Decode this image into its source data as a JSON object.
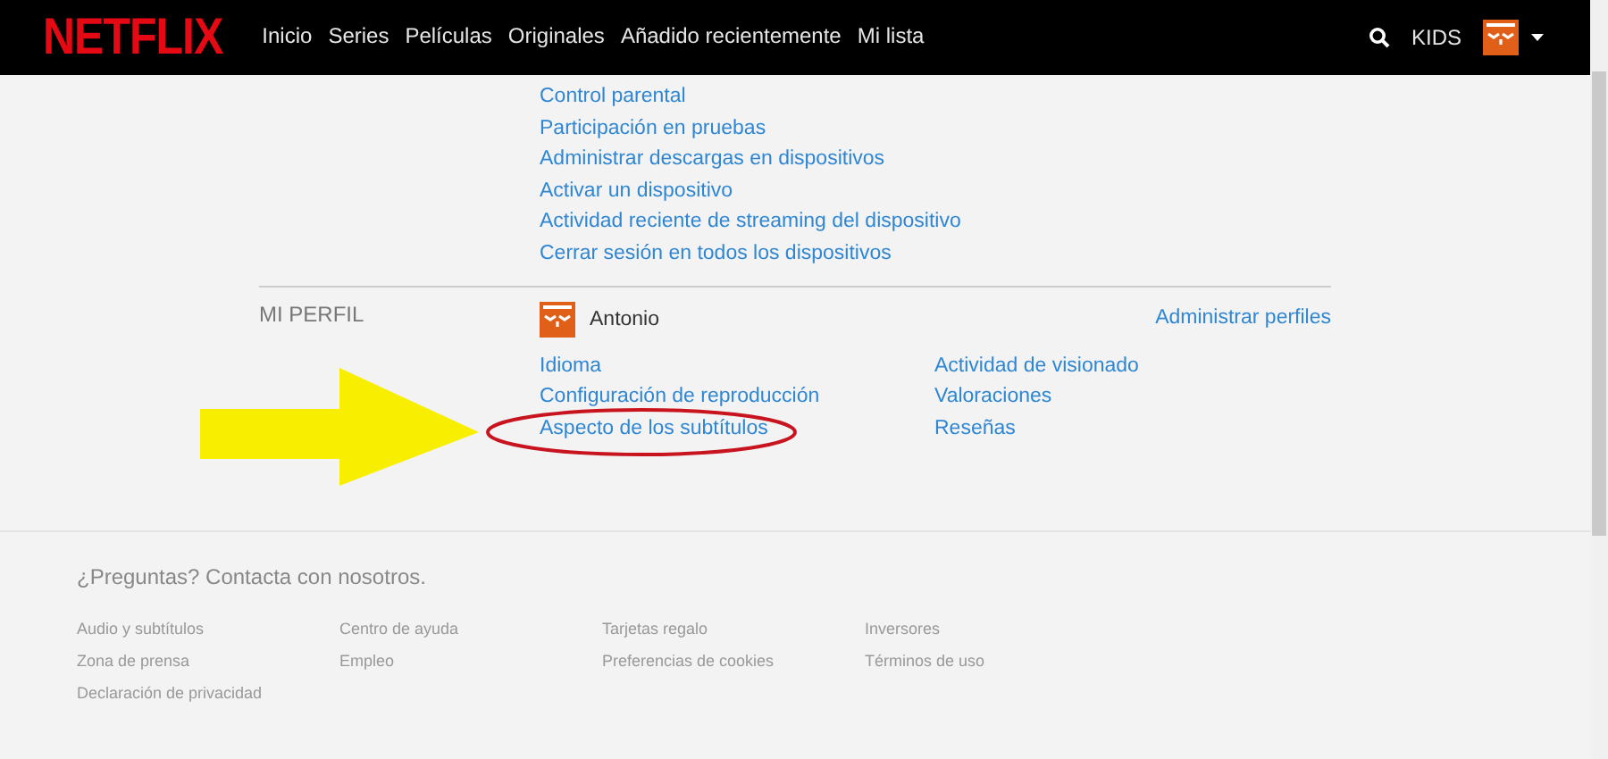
{
  "header": {
    "logo": "NETFLIX",
    "nav": [
      {
        "label": "Inicio"
      },
      {
        "label": "Series"
      },
      {
        "label": "Películas"
      },
      {
        "label": "Originales"
      },
      {
        "label": "Añadido recientemente"
      },
      {
        "label": "Mi lista"
      }
    ],
    "kids": "KIDS"
  },
  "settings_links": [
    "Control parental",
    "Participación en pruebas",
    "Administrar descargas en dispositivos",
    "Activar un dispositivo",
    "Actividad reciente de streaming del dispositivo",
    "Cerrar sesión en todos los dispositivos"
  ],
  "profile": {
    "section_label": "MI PERFIL",
    "name": "Antonio",
    "manage": "Administrar perfiles",
    "links_left": [
      "Idioma",
      "Configuración de reproducción",
      "Aspecto de los subtítulos"
    ],
    "links_right": [
      "Actividad de visionado",
      "Valoraciones",
      "Reseñas"
    ]
  },
  "annotations": [
    {
      "kind": "arrow",
      "color": "#f7ee00"
    },
    {
      "kind": "ellipse",
      "color": "#c8141e"
    }
  ],
  "footer": {
    "contact": "¿Preguntas? Contacta con nosotros.",
    "links": [
      "Audio y subtítulos",
      "Centro de ayuda",
      "Tarjetas regalo",
      "Inversores",
      "Zona de prensa",
      "Empleo",
      "Preferencias de cookies",
      "Términos de uso",
      "Declaración de privacidad"
    ]
  }
}
